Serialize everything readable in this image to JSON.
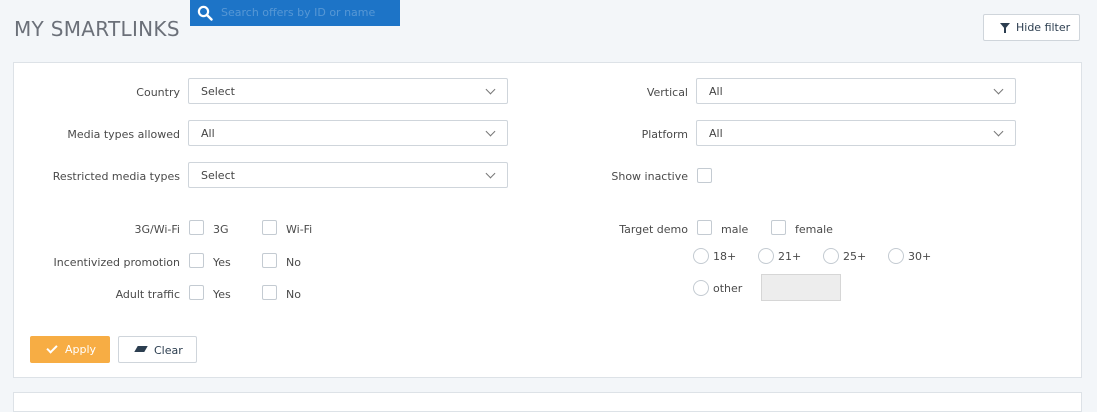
{
  "header": {
    "title": "MY SMARTLINKS",
    "search_placeholder": "Search offers by ID or name",
    "hide_filter_label": "Hide filter"
  },
  "filters": {
    "country": {
      "label": "Country",
      "value": "Select"
    },
    "media_types_allowed": {
      "label": "Media types allowed",
      "value": "All"
    },
    "restricted_media_types": {
      "label": "Restricted media types",
      "value": "Select"
    },
    "vertical": {
      "label": "Vertical",
      "value": "All"
    },
    "platform": {
      "label": "Platform",
      "value": "All"
    },
    "show_inactive": {
      "label": "Show inactive"
    },
    "connection": {
      "label": "3G/Wi-Fi",
      "opt1": "3G",
      "opt2": "Wi-Fi"
    },
    "incentivized": {
      "label": "Incentivized promotion",
      "opt1": "Yes",
      "opt2": "No"
    },
    "adult": {
      "label": "Adult traffic",
      "opt1": "Yes",
      "opt2": "No"
    },
    "target_demo": {
      "label": "Target demo",
      "male": "male",
      "female": "female",
      "ages": [
        "18+",
        "21+",
        "25+",
        "30+"
      ],
      "other": "other"
    }
  },
  "actions": {
    "apply_label": "Apply",
    "clear_label": "Clear"
  },
  "colors": {
    "accent_blue": "#1d74c7",
    "apply_orange": "#f7ad44"
  }
}
